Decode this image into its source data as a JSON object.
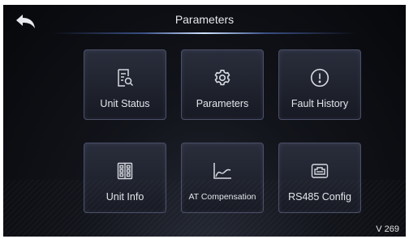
{
  "header": {
    "title": "Parameters",
    "back_icon": "back-arrow-icon"
  },
  "tiles": [
    {
      "label": "Unit Status",
      "icon": "document-search-icon"
    },
    {
      "label": "Parameters",
      "icon": "gear-icon"
    },
    {
      "label": "Fault History",
      "icon": "alert-circle-icon"
    },
    {
      "label": "Unit Info",
      "icon": "unit-info-icon"
    },
    {
      "label": "AT Compensation",
      "icon": "curve-chart-icon"
    },
    {
      "label": "RS485 Config",
      "icon": "network-port-icon"
    }
  ],
  "footer": {
    "version": "V 269"
  },
  "colors": {
    "accent_line": "#cfe2ff",
    "tile_border": "#4b5068",
    "text": "#e3e5ea"
  }
}
